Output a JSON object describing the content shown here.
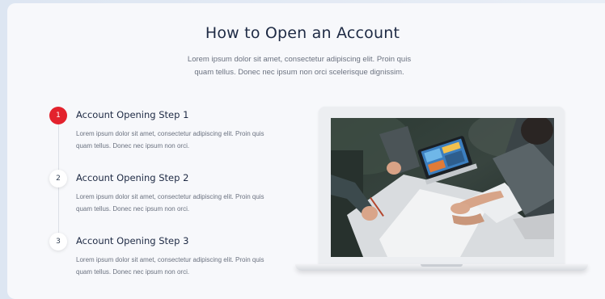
{
  "header": {
    "title": "How to Open an Account",
    "subtitle": "Lorem ipsum dolor sit amet, consectetur adipiscing elit. Proin quis quam tellus. Donec nec ipsum non orci scelerisque dignissim."
  },
  "steps": [
    {
      "number": "1",
      "title": "Account Opening Step 1",
      "description": "Lorem ipsum dolor sit amet, consectetur adipiscing elit. Proin quis quam tellus. Donec nec ipsum non orci.",
      "active": true
    },
    {
      "number": "2",
      "title": "Account Opening Step 2",
      "description": "Lorem ipsum dolor sit amet, consectetur adipiscing elit. Proin quis quam tellus. Donec nec ipsum non orci.",
      "active": false
    },
    {
      "number": "3",
      "title": "Account Opening Step 3",
      "description": "Lorem ipsum dolor sit amet, consectetur adipiscing elit. Proin quis quam tellus. Donec nec ipsum non orci.",
      "active": false
    }
  ],
  "colors": {
    "accent": "#e3222d",
    "heading": "#1e2a44",
    "body_text": "#6b7280"
  },
  "image": {
    "icon": "team-meeting-photo"
  }
}
